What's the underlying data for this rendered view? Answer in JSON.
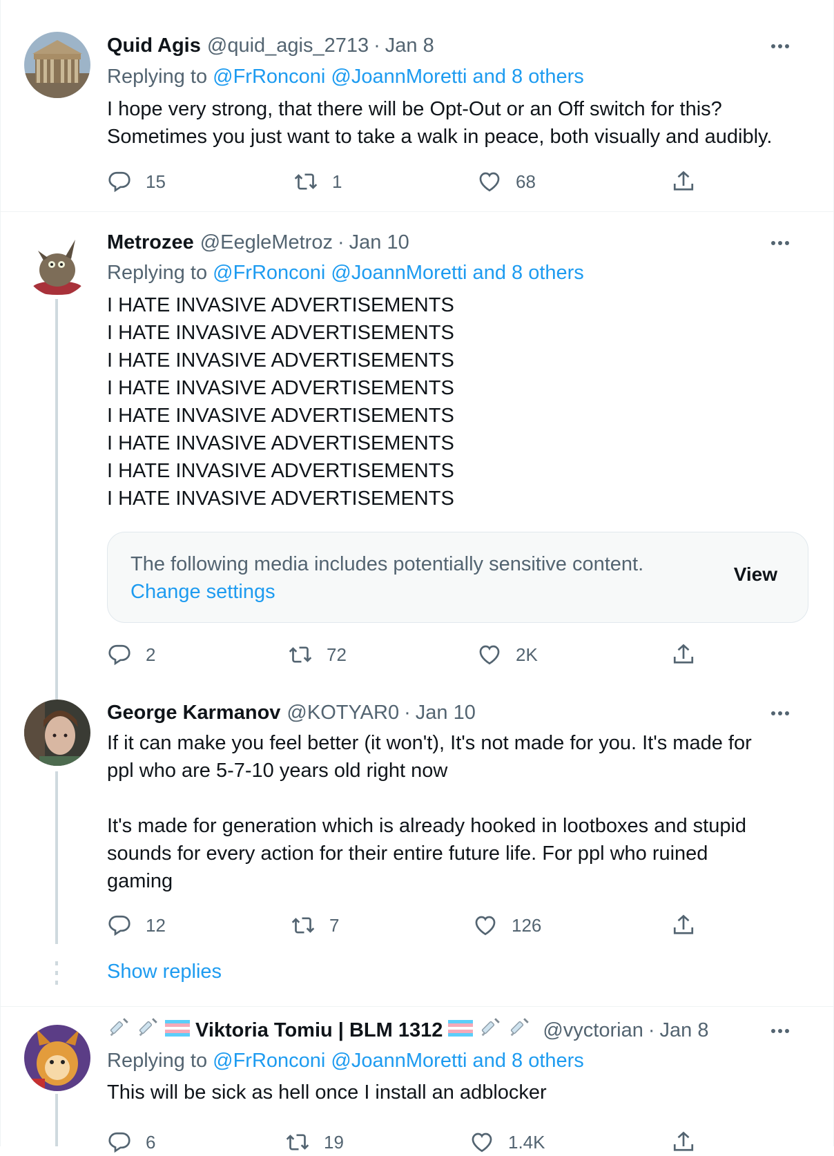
{
  "tweets": [
    {
      "name": "Quid Agis",
      "handle": "@quid_agis_2713",
      "date": "Jan 8",
      "replying_prefix": "Replying to ",
      "replying_links": "@FrRonconi @JoannMoretti and 8 others",
      "body": [
        "I hope very strong, that there will be Opt-Out or an Off switch for this?",
        "Sometimes you just want to take a walk in peace, both visually and audibly."
      ],
      "replies": "15",
      "retweets": "1",
      "likes": "68"
    },
    {
      "name": "Metrozee",
      "handle": "@EegleMetroz",
      "date": "Jan 10",
      "replying_prefix": "Replying to ",
      "replying_links": "@FrRonconi @JoannMoretti and 8 others",
      "body": [
        "I HATE INVASIVE ADVERTISEMENTS",
        "I HATE INVASIVE ADVERTISEMENTS",
        "I HATE INVASIVE ADVERTISEMENTS",
        "I HATE INVASIVE ADVERTISEMENTS",
        "I HATE INVASIVE ADVERTISEMENTS",
        "I HATE INVASIVE ADVERTISEMENTS",
        "I HATE INVASIVE ADVERTISEMENTS",
        "I HATE INVASIVE ADVERTISEMENTS"
      ],
      "sensitive_notice": "The following media includes potentially sensitive content.",
      "sensitive_change": "Change settings",
      "sensitive_view": "View",
      "replies": "2",
      "retweets": "72",
      "likes": "2K"
    },
    {
      "name": "George Karmanov",
      "handle": "@KOTYAR0",
      "date": "Jan 10",
      "body": [
        "If it can make you feel better (it won't), It's not made for you. It's made for",
        "ppl who are 5-7-10 years old right now",
        "",
        "It's made for generation which is already hooked in lootboxes and stupid",
        "sounds for every action for their entire future life. For ppl who ruined",
        "gaming"
      ],
      "replies": "12",
      "retweets": "7",
      "likes": "126",
      "show_replies": "Show replies"
    },
    {
      "name": "Viktoria Tomiu | BLM 1312",
      "handle": "@vyctorian",
      "date": "Jan 8",
      "replying_prefix": "Replying to ",
      "replying_links": "@FrRonconi @JoannMoretti and 8 others",
      "body": [
        "This will be sick as hell once I install an adblocker"
      ],
      "replies": "6",
      "retweets": "19",
      "likes": "1.4K"
    }
  ],
  "colors": {
    "link": "#1d9bf0",
    "muted": "#536471",
    "text": "#0f1419",
    "border": "#eff3f4"
  }
}
